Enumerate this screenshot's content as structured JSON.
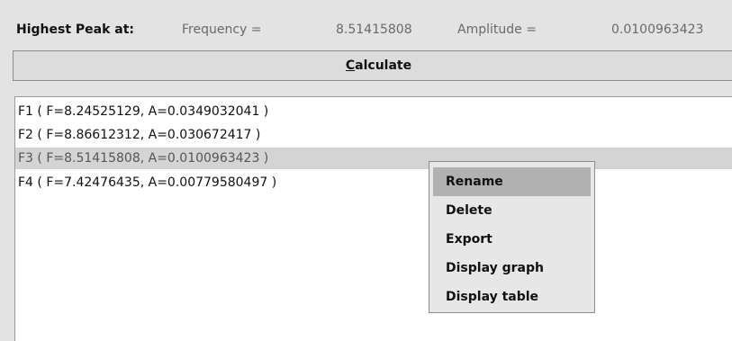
{
  "peak_info": {
    "title": "Highest Peak at:",
    "frequency_label": "Frequency =",
    "frequency_value": "8.51415808",
    "amplitude_label": "Amplitude =",
    "amplitude_value": "0.0100963423"
  },
  "calculate_button": {
    "mnemonic": "C",
    "rest": "alculate"
  },
  "results": {
    "selected_index": 2,
    "items": [
      {
        "label": "F1 ( F=8.24525129, A=0.0349032041 )"
      },
      {
        "label": "F2 ( F=8.86612312, A=0.030672417 )"
      },
      {
        "label": "F3 ( F=8.51415808, A=0.0100963423 )"
      },
      {
        "label": "F4 ( F=7.42476435, A=0.00779580497 )"
      }
    ]
  },
  "context_menu": {
    "active_index": 0,
    "items": [
      {
        "label": "Rename"
      },
      {
        "label": "Delete"
      },
      {
        "label": "Export"
      },
      {
        "label": "Display graph"
      },
      {
        "label": "Display table"
      }
    ]
  }
}
